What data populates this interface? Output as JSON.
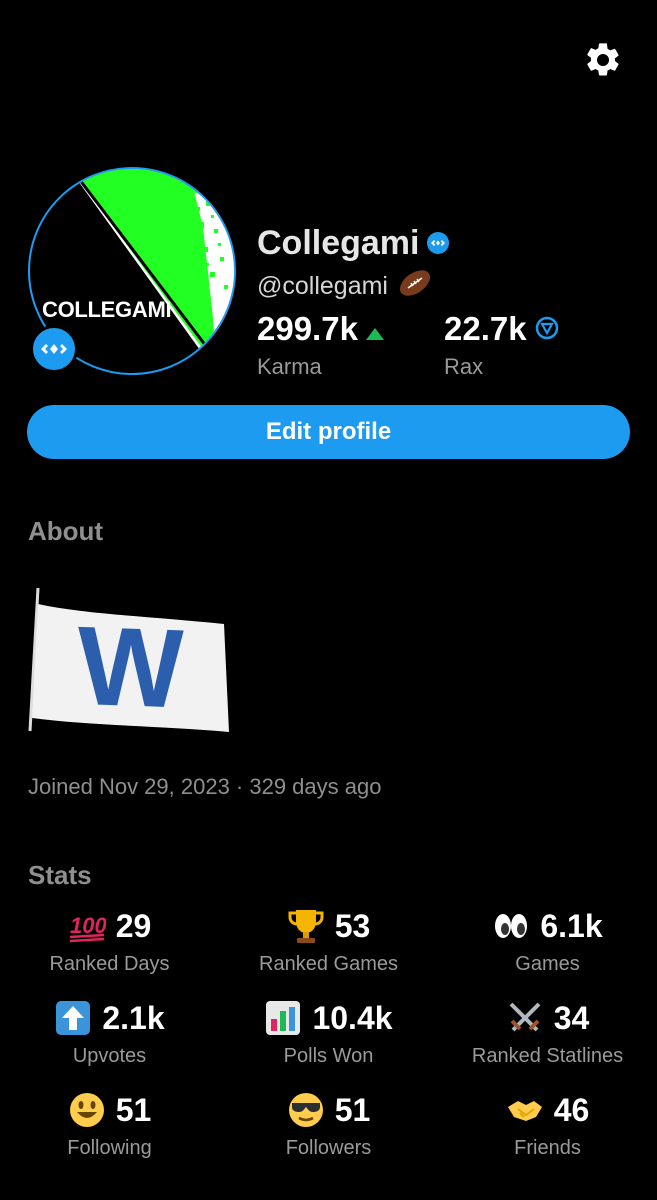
{
  "profile": {
    "avatar_text": "COLLEGAMI",
    "name": "Collegami",
    "handle": "@collegami",
    "karma_value": "299.7k",
    "karma_label": "Karma",
    "rax_value": "22.7k",
    "rax_label": "Rax",
    "edit_button": "Edit profile"
  },
  "about": {
    "title": "About",
    "flag_letter": "W",
    "joined": "Joined Nov 29, 2023 · 329 days ago"
  },
  "stats": {
    "title": "Stats",
    "items": [
      {
        "icon": "hundred-points-icon",
        "value": "29",
        "label": "Ranked Days"
      },
      {
        "icon": "trophy-icon",
        "value": "53",
        "label": "Ranked Games"
      },
      {
        "icon": "eyes-icon",
        "value": "6.1k",
        "label": "Games"
      },
      {
        "icon": "up-arrow-icon",
        "value": "2.1k",
        "label": "Upvotes"
      },
      {
        "icon": "bar-chart-icon",
        "value": "10.4k",
        "label": "Polls Won"
      },
      {
        "icon": "crossed-swords-icon",
        "value": "34",
        "label": "Ranked Statlines"
      },
      {
        "icon": "smiley-icon",
        "value": "51",
        "label": "Following"
      },
      {
        "icon": "sunglasses-face-icon",
        "value": "51",
        "label": "Followers"
      },
      {
        "icon": "handshake-icon",
        "value": "46",
        "label": "Friends"
      }
    ]
  },
  "colors": {
    "accent": "#1d9bf0",
    "karma_up": "#1db954",
    "avatar_green": "#22ff22"
  }
}
